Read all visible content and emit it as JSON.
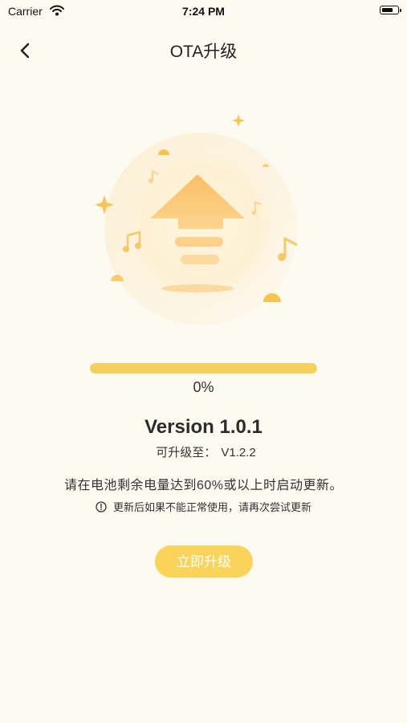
{
  "status_bar": {
    "carrier": "Carrier",
    "time": "7:24 PM"
  },
  "nav": {
    "title": "OTA升级",
    "back_icon": "chevron-left-icon"
  },
  "progress": {
    "value": 0,
    "label": "0%"
  },
  "version": {
    "current": "Version 1.0.1",
    "upgrade_label": "可升级至：",
    "target": "V1.2.2"
  },
  "notes": {
    "battery": "请在电池剩余电量达到60%或以上时启动更新。",
    "warning": "更新后如果不能正常使用，请再次尝试更新"
  },
  "action": {
    "upgrade_label": "立即升级"
  },
  "colors": {
    "background": "#fdfaf1",
    "progress_track": "#f3d15c",
    "button": "#f9d35a"
  }
}
